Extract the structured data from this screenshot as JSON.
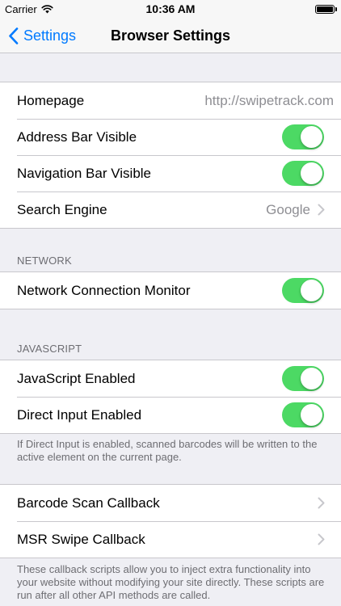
{
  "status_bar": {
    "carrier": "Carrier",
    "time": "10:36 AM",
    "battery_level": 1.0
  },
  "nav": {
    "back_label": "Settings",
    "title": "Browser Settings"
  },
  "general": {
    "homepage_label": "Homepage",
    "homepage_value": "http://swipetrack.com",
    "address_bar_label": "Address Bar Visible",
    "address_bar_on": true,
    "navigation_bar_label": "Navigation Bar Visible",
    "navigation_bar_on": true,
    "search_engine_label": "Search Engine",
    "search_engine_value": "Google"
  },
  "network": {
    "header": "NETWORK",
    "monitor_label": "Network Connection Monitor",
    "monitor_on": true
  },
  "javascript": {
    "header": "JAVASCRIPT",
    "enabled_label": "JavaScript Enabled",
    "enabled_on": true,
    "direct_input_label": "Direct Input Enabled",
    "direct_input_on": true,
    "footer": "If Direct Input is enabled, scanned barcodes will be written to the active element on the current page."
  },
  "callbacks": {
    "barcode_label": "Barcode Scan Callback",
    "msr_label": "MSR Swipe Callback",
    "footer": "These callback scripts allow you to inject extra functionality into your website without modifying your site directly. These scripts are run after all other API methods are called."
  },
  "colors": {
    "accent": "#007aff",
    "toggle_on": "#4cd964",
    "background": "#efeff4",
    "separator": "#c8c7cc",
    "secondary_text": "#8e8e93"
  },
  "icons": {
    "back": "chevron-left-icon",
    "disclosure": "chevron-right-icon",
    "wifi": "wifi-icon",
    "battery": "battery-icon"
  }
}
